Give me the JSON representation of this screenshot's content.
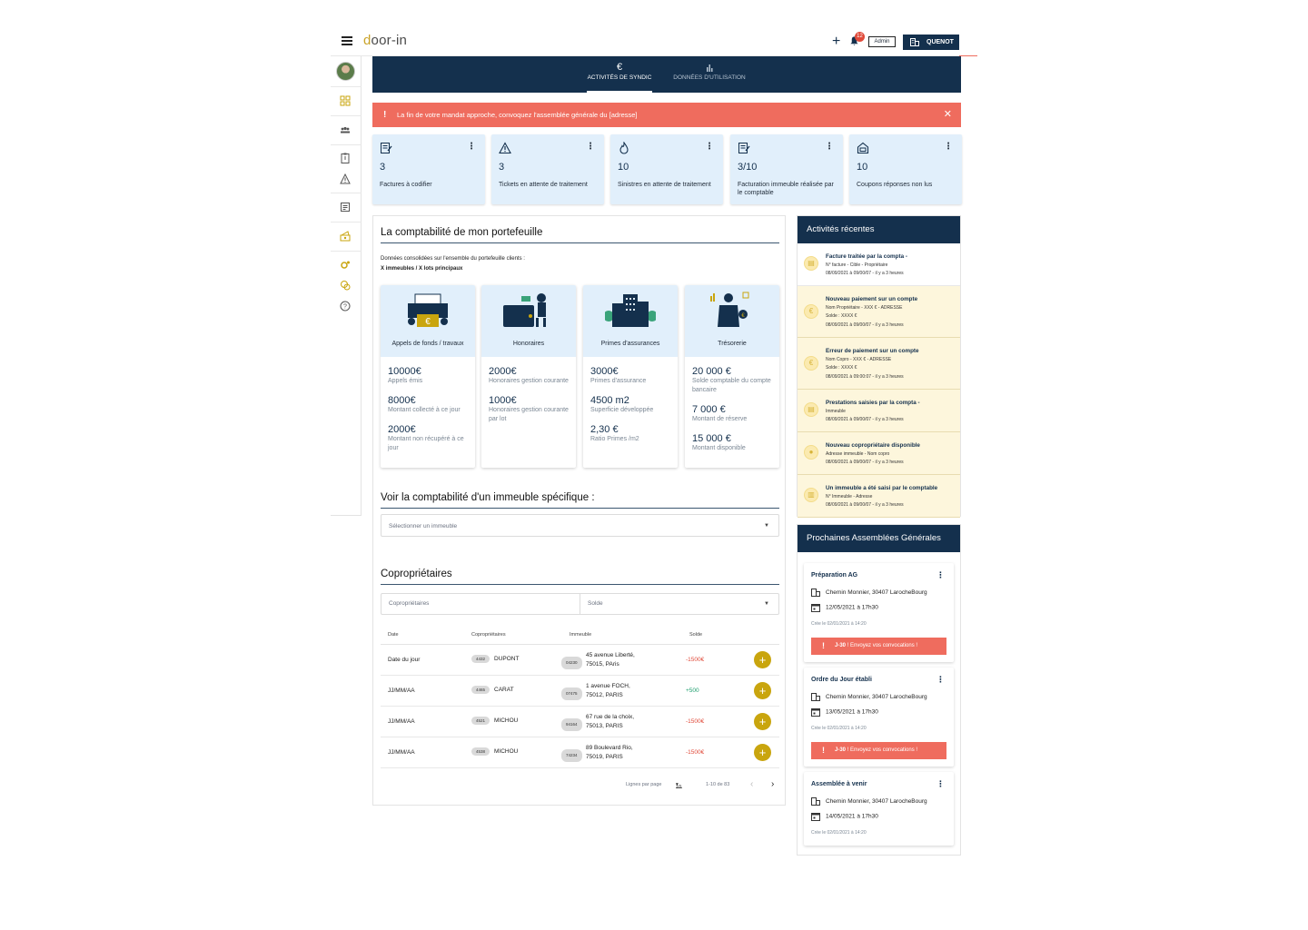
{
  "topbar": {
    "logo_prefix": "d",
    "logo_rest": "oor-in",
    "notification_count": "12",
    "admin_label": "Admin",
    "user_label": "QUENOT"
  },
  "nav": {
    "tabs": [
      {
        "label": "ACTIVITÉS DE SYNDIC",
        "icon": "euro-icon",
        "active": true
      },
      {
        "label": "DONNÉES D'UTILISATION",
        "icon": "bar-chart-icon",
        "active": false
      }
    ]
  },
  "alert": {
    "icon": "!",
    "text": "La fin de votre mandat approche, convoquez l'assemblée générale du [adresse]",
    "color": "#ef6c5e"
  },
  "kpis": [
    {
      "icon": "invoice-icon",
      "value": "3",
      "label": "Factures à codifier"
    },
    {
      "icon": "warning-icon",
      "value": "3",
      "label": "Tickets en attente de traitement"
    },
    {
      "icon": "fire-icon",
      "value": "10",
      "label": "Sinistres en attente de traitement"
    },
    {
      "icon": "invoice-icon",
      "value": "3/10",
      "label": "Facturation immeuble réalisée par le comptable"
    },
    {
      "icon": "mailbox-icon",
      "value": "10",
      "label": "Coupons réponses non lus"
    }
  ],
  "portfolio": {
    "title": "La comptabilité de mon portefeuille",
    "intro_line1": "Données consolidées sur l'ensemble du portefeuille clients :",
    "intro_line2": "X immeubles / X lots principaux",
    "cards": [
      {
        "title": "Appels de fonds / travaux",
        "items": [
          {
            "value": "10000€",
            "label": "Appels émis"
          },
          {
            "value": "8000€",
            "label": "Montant collecté à ce jour"
          },
          {
            "value": "2000€",
            "label": "Montant non récupéré à ce jour"
          }
        ]
      },
      {
        "title": "Honoraires",
        "items": [
          {
            "value": "2000€",
            "label": "Honoraires gestion courante"
          },
          {
            "value": "1000€",
            "label": "Honoraires gestion courante par lot"
          }
        ]
      },
      {
        "title": "Primes d'assurances",
        "items": [
          {
            "value": "3000€",
            "label": "Primes d'assurance"
          },
          {
            "value": "4500 m2",
            "label": "Superficie développée"
          },
          {
            "value": "2,30 €",
            "label": "Ratio Primes /m2"
          }
        ]
      },
      {
        "title": "Trésorerie",
        "items": [
          {
            "value": "20 000 €",
            "label": "Solde comptable du compte bancaire"
          },
          {
            "value": "7 000 €",
            "label": "Montant de réserve"
          },
          {
            "value": "15 000 €",
            "label": "Montant disponible"
          }
        ]
      }
    ]
  },
  "building": {
    "title": "Voir la comptabilité d'un immeuble spécifique :",
    "select_placeholder": "Sélectionner un immeuble"
  },
  "owners": {
    "title": "Copropriétaires",
    "filter_placeholder": "Copropriétaires",
    "solde_placeholder": "Solde",
    "columns": [
      "Date",
      "Copropriétaires",
      "Immeuble",
      "Solde"
    ],
    "rows": [
      {
        "date": "Date du jour",
        "owner_id": "4432",
        "owner": "DUPONT",
        "bld_id": "04230",
        "addr1": "45 avenue Liberté,",
        "addr2": "75015, PAris",
        "solde": "-1500€",
        "sign": "neg"
      },
      {
        "date": "JJ/MM/AA",
        "owner_id": "4465",
        "owner": "CARAT",
        "bld_id": "07475",
        "addr1": "1 avenue FOCH,",
        "addr2": "75012, PARIS",
        "solde": "+500",
        "sign": "pos"
      },
      {
        "date": "JJ/MM/AA",
        "owner_id": "4521",
        "owner": "MICHOU",
        "bld_id": "94164",
        "addr1": "67 rue de la choix,",
        "addr2": "75013, PARIS",
        "solde": "-1500€",
        "sign": "neg"
      },
      {
        "date": "JJ/MM/AA",
        "owner_id": "4538",
        "owner": "MICHOU",
        "bld_id": "74234",
        "addr1": "89 Boulevard Rio,",
        "addr2": "75019, PARIS",
        "solde": "-1500€",
        "sign": "neg"
      }
    ],
    "pager": {
      "rows_label": "Lignes par page",
      "per_page": "10",
      "range": "1-10 de 83"
    }
  },
  "activities": {
    "title": "Activités récentes",
    "items": [
      {
        "title": "Facture traitée par la compta  -",
        "lines": [
          "N° facture - Cible - Propriétaire"
        ],
        "time": "08/09/2021 à 09/00/07 - il y a 3 heures",
        "icon": "document-icon"
      },
      {
        "title": "Nouveau paiement sur un compte",
        "lines": [
          "Nom Propriétaire - XXX € - ADRESSE",
          "Solde : XXXX €"
        ],
        "time": "08/09/2021 à 09/00/07 - il y a 3 heures",
        "icon": "euro-icon"
      },
      {
        "title": "Erreur de paiement sur un compte",
        "lines": [
          "Nom Copro - XXX € - ADRESSE",
          "Solde : XXXX €"
        ],
        "time": "08/09/2021 à 09:00:07 - il y a 3 heures",
        "icon": "euro-icon"
      },
      {
        "title": "Prestations saisies par la compta  -",
        "lines": [
          "Immeuble"
        ],
        "time": "08/09/2021 à 09/00/07 - il y a 3 heures",
        "icon": "document-icon"
      },
      {
        "title": "Nouveau copropriétaire disponible",
        "lines": [
          "Adresse immeuble - Nom copro"
        ],
        "time": "08/09/2021 à 09/00/07 - il y a 3 heures",
        "icon": "person-icon"
      },
      {
        "title": "Un immeuble a été saisi par le comptable",
        "lines": [
          "N° Immeuble - Adresse"
        ],
        "time": "08/09/2021 à 09/00/07 - il y a 3 heures",
        "icon": "building-icon"
      }
    ]
  },
  "ag": {
    "title": "Prochaines Assemblées Générales",
    "cards": [
      {
        "title": "Préparation AG",
        "address": "Chemin Monnier, 30407 LarocheBourg",
        "date": "12/05/2021 à 17h30",
        "created": "Crée le 02/01/2021 à 14:20",
        "cta_bold": "J-30",
        "cta": "! Envoyez vos convocations !"
      },
      {
        "title": "Ordre du Jour établi",
        "address": "Chemin Monnier, 30407 LarocheBourg",
        "date": "13/05/2021 à 17h30",
        "created": "Crée le 02/01/2021 à 14:20",
        "cta_bold": "J-30",
        "cta": "! Envoyez vos convocations !"
      },
      {
        "title": "Assemblée à venir",
        "address": "Chemin Monnier, 30407 LarocheBourg",
        "date": "14/05/2021 à 17h30",
        "created": "Crée le 02/01/2021 à 14:20"
      }
    ]
  },
  "colors": {
    "navy": "#14304d",
    "light_blue": "#e1effb",
    "alert_red": "#ef6c5e",
    "gold": "#c9a50e",
    "activity_bg": "#fdf6dc"
  }
}
